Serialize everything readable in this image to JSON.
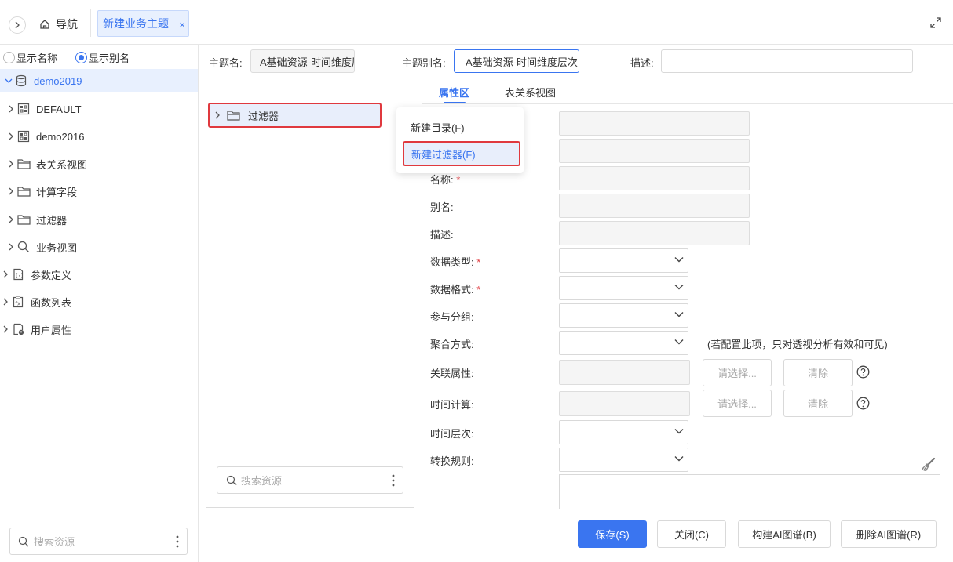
{
  "topbar": {
    "nav_label": "导航",
    "active_tab": "新建业务主题",
    "close_glyph": "×"
  },
  "sidebar": {
    "radio_show_name": "显示名称",
    "radio_show_alias": "显示别名",
    "selected_radio": "显示别名",
    "root": "demo2019",
    "items": [
      {
        "label": "DEFAULT",
        "icon": "schema-icon"
      },
      {
        "label": "demo2016",
        "icon": "schema-icon"
      },
      {
        "label": "表关系视图",
        "icon": "folder-icon"
      },
      {
        "label": "计算字段",
        "icon": "folder-icon"
      },
      {
        "label": "过滤器",
        "icon": "folder-icon"
      },
      {
        "label": "业务视图",
        "icon": "search-icon"
      },
      {
        "label": "参数定义",
        "icon": "parameter-icon"
      },
      {
        "label": "函数列表",
        "icon": "function-icon"
      },
      {
        "label": "用户属性",
        "icon": "user-attribute-icon"
      }
    ],
    "search_placeholder": "搜索资源"
  },
  "header": {
    "topic_name_label": "主题名:",
    "topic_name_value": "A基础资源-时间维度层次",
    "topic_alias_label": "主题别名:",
    "topic_alias_value": "A基础资源-时间维度层次",
    "desc_label": "描述:",
    "desc_value": ""
  },
  "tabs": [
    "属性区",
    "表关系视图"
  ],
  "active_tab_index": 0,
  "resource_tree": {
    "node": "过滤器",
    "search_placeholder": "搜索资源"
  },
  "context_menu": {
    "items": [
      "新建目录(F)",
      "新建过滤器(F)"
    ],
    "highlighted": "新建过滤器(F)"
  },
  "properties": {
    "name_label": "名称:",
    "alias_label": "别名:",
    "desc_label": "描述:",
    "data_type_label": "数据类型:",
    "data_format_label": "数据格式:",
    "group_label": "参与分组:",
    "agg_label": "聚合方式:",
    "agg_hint": "(若配置此项，只对透视分析有效和可见)",
    "rel_attr_label": "关联属性:",
    "time_calc_label": "时间计算:",
    "time_level_label": "时间层次:",
    "convert_rule_label": "转换规则:",
    "required_mark": "*",
    "choose_btn": "请选择...",
    "clear_btn": "清除"
  },
  "footer": {
    "save": "保存(S)",
    "close": "关闭(C)",
    "build_ai": "构建AI图谱(B)",
    "delete_ai": "删除AI图谱(R)"
  },
  "colors": {
    "accent": "#3a75f0",
    "highlight_border": "#e0393e",
    "selected_bg": "#e8f0fe"
  }
}
